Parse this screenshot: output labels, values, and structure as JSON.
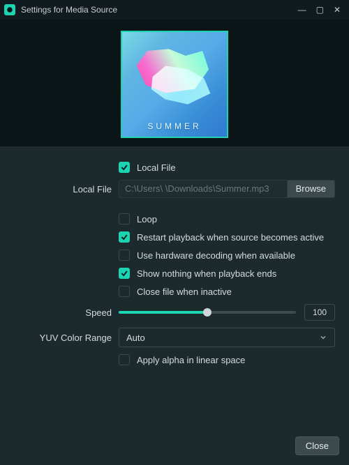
{
  "window": {
    "title": "Settings for Media Source"
  },
  "preview": {
    "album_text": "SUMMER"
  },
  "form": {
    "local_file_enabled": {
      "label": "Local File",
      "checked": true
    },
    "local_file": {
      "label": "Local File",
      "path": "C:\\Users\\            \\Downloads\\Summer.mp3",
      "browse": "Browse"
    },
    "checks": {
      "loop": {
        "label": "Loop",
        "checked": false
      },
      "restart": {
        "label": "Restart playback when source becomes active",
        "checked": true
      },
      "hw_decode": {
        "label": "Use hardware decoding when available",
        "checked": false
      },
      "show_nothing": {
        "label": "Show nothing when playback ends",
        "checked": true
      },
      "close_inactive": {
        "label": "Close file when inactive",
        "checked": false
      },
      "apply_alpha": {
        "label": "Apply alpha in linear space",
        "checked": false
      }
    },
    "speed": {
      "label": "Speed",
      "value": "100",
      "percent": 50
    },
    "yuv": {
      "label": "YUV Color Range",
      "value": "Auto"
    }
  },
  "footer": {
    "close": "Close"
  },
  "colors": {
    "accent": "#1dd3b0"
  }
}
